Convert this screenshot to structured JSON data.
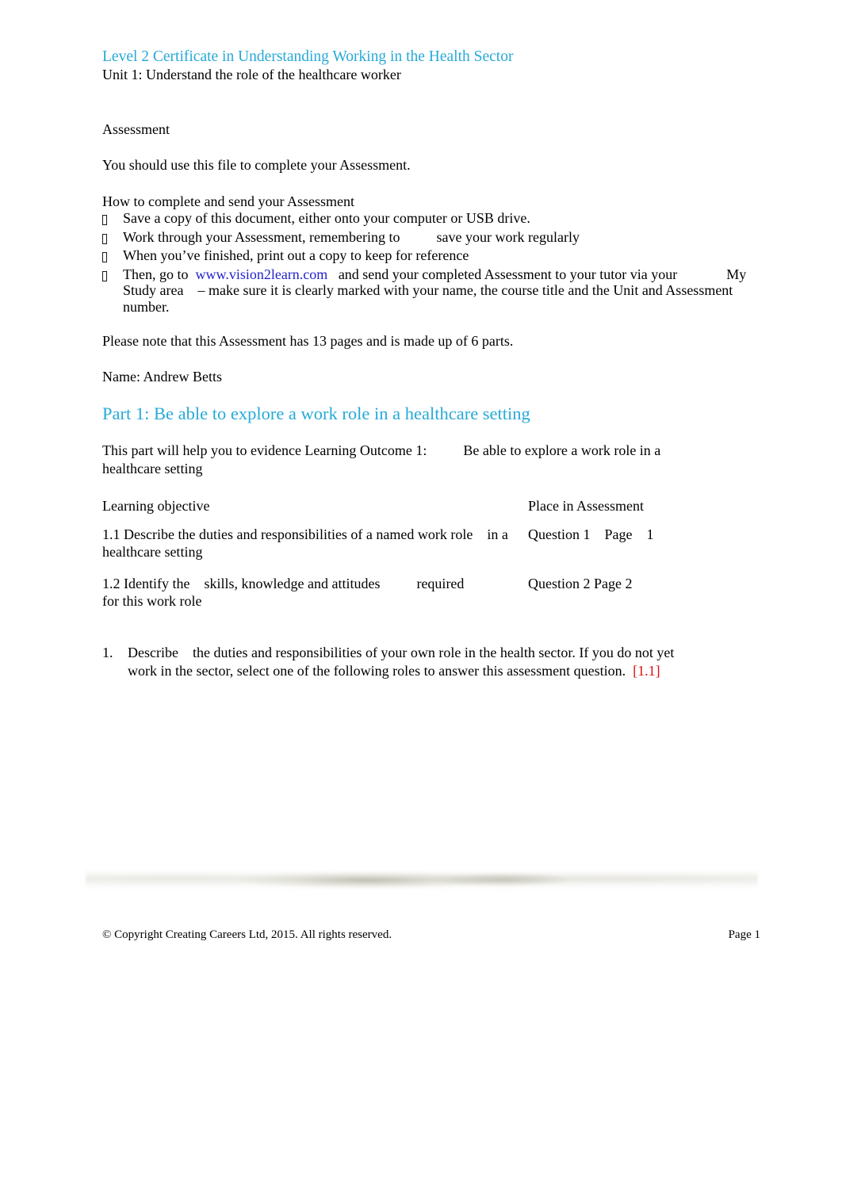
{
  "document": {
    "header": {
      "title": "Level 2 Certificate in Understanding Working in the Health Sector",
      "subtitle": "Unit 1: Understand the role of the healthcare worker",
      "title_color": "#27A9D8"
    },
    "intro": {
      "assessment_label": "Assessment",
      "use_file_line": "You should use this file to complete your Assessment.",
      "howto_label": "How to complete and send your Assessment"
    },
    "instructions": {
      "bullet_glyph": "missing-glyph-box-icon",
      "items": [
        {
          "id": "save-copy",
          "parts": [
            {
              "type": "text",
              "value": "Save a copy of this document, either onto your computer or USB drive."
            }
          ]
        },
        {
          "id": "work-through",
          "parts": [
            {
              "type": "text",
              "value": "Work through your Assessment, remembering to"
            },
            {
              "type": "tab"
            },
            {
              "type": "text",
              "value": "save your work regularly"
            }
          ]
        },
        {
          "id": "print-copy",
          "parts": [
            {
              "type": "text",
              "value": "When you’ve finished, print out a copy to keep for reference"
            }
          ]
        },
        {
          "id": "send-to-tutor",
          "parts": [
            {
              "type": "text",
              "value": "Then, go to"
            },
            {
              "type": "link",
              "value": "www.vision2learn.com",
              "color": "#2222CC"
            },
            {
              "type": "text",
              "value": "and send your completed Assessment to your tutor via your"
            },
            {
              "type": "tab-large"
            },
            {
              "type": "text",
              "value": "My Study area"
            },
            {
              "type": "tab-small"
            },
            {
              "type": "text",
              "value": "– make sure it is clearly marked with your name, the course title and the Unit and Assessment number."
            }
          ]
        }
      ],
      "bullet_1_text": "Save a copy of this document, either onto your computer or USB drive.",
      "bullet_2_text_a": "Work through your Assessment, remembering to",
      "bullet_2_text_b": "save your work regularly",
      "bullet_3_text": "When you’ve finished, print out a copy to keep for reference",
      "bullet_4_text_a": "Then, go to",
      "bullet_4_link": "www.vision2learn.com",
      "bullet_4_text_b": "and send your completed Assessment to your tutor via your",
      "bullet_4_text_c": "My",
      "bullet_4_text_d": "Study area",
      "bullet_4_text_e": "– make sure it is clearly marked with your name, the course title and the Unit and Assessment number."
    },
    "notes": {
      "pages_note": "Please note that this Assessment has 13 pages and is made up of 6 parts.",
      "page_count": "13",
      "part_count": "6",
      "name_line": "Name: Andrew Betts",
      "student_name": "Andrew Betts"
    },
    "part": {
      "heading": "Part 1: Be able to explore a work role in a healthcare setting",
      "heading_color": "#27A9D8",
      "intro_a": "This part will help you to evidence Learning Outcome 1:",
      "intro_b": "Be able to explore a work role in a healthcare setting"
    },
    "objectives_table": {
      "columns": {
        "left": "Learning objective",
        "right": "Place in Assessment"
      },
      "rows": [
        {
          "left_a": "1.1 Describe the duties and responsibilities of a named",
          "left_b": "work role",
          "left_c": "in a healthcare setting",
          "right_a": "Question 1",
          "right_b": "Page",
          "right_c": "1"
        },
        {
          "left_a": "1.2 Identify the",
          "left_b": "skills, knowledge and attitudes",
          "left_c": "required",
          "left_d": "for this work role",
          "right_a": "Question 2 Page 2",
          "right_b": "",
          "right_c": ""
        }
      ]
    },
    "question": {
      "number": "1.",
      "text_a": "Describe",
      "text_b": "the duties and responsibilities of your own role in the health sector. If you do not yet work in the sector, select one of the following roles to answer this assessment question.",
      "reference": "[1.1]",
      "reference_color": "#DD0D0D"
    },
    "footer": {
      "copyright": "© Copyright Creating Careers Ltd, 2015. All rights reserved.",
      "page_label": "Page 1"
    }
  }
}
